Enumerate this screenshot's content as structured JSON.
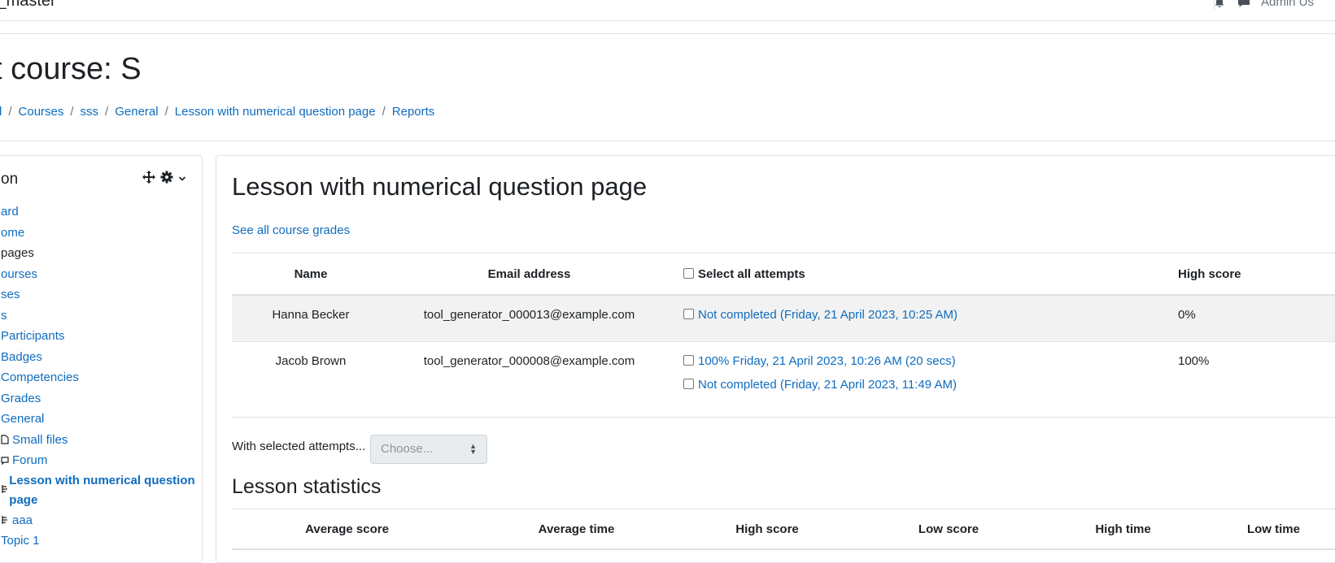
{
  "navbar": {
    "site_name": "l_master",
    "user_name": "Admin Us"
  },
  "header": {
    "page_title": "t course: S",
    "breadcrumb": [
      "d",
      "Courses",
      "sss",
      "General",
      "Lesson with numerical question page",
      "Reports"
    ]
  },
  "navigation_block": {
    "title": "on",
    "items": [
      {
        "label": "ard",
        "type": "link"
      },
      {
        "label": "ome",
        "type": "link"
      },
      {
        "label": "pages",
        "type": "static"
      },
      {
        "label": "ourses",
        "type": "link"
      },
      {
        "label": "ses",
        "type": "link"
      },
      {
        "label": "s",
        "type": "link"
      },
      {
        "label": "Participants",
        "type": "link"
      },
      {
        "label": "Badges",
        "type": "link"
      },
      {
        "label": "Competencies",
        "type": "link"
      },
      {
        "label": "Grades",
        "type": "link"
      },
      {
        "label": "General",
        "type": "link"
      },
      {
        "label": "Small files",
        "type": "link",
        "icon": "file-icon"
      },
      {
        "label": "Forum",
        "type": "link",
        "icon": "forum-icon"
      },
      {
        "label": "Lesson with numerical question page",
        "type": "current",
        "icon": "lesson-icon"
      },
      {
        "label": "aaa",
        "type": "link",
        "icon": "lesson-icon"
      },
      {
        "label": "Topic 1",
        "type": "link"
      }
    ]
  },
  "main": {
    "lesson_title": "Lesson with numerical question page",
    "see_all_grades": "See all course grades",
    "attempts_table": {
      "headers": {
        "name": "Name",
        "email": "Email address",
        "select_all": "Select all attempts",
        "high_score": "High score"
      },
      "rows": [
        {
          "name": "Hanna Becker",
          "email": "tool_generator_000013@example.com",
          "attempts": [
            "Not completed (Friday, 21 April 2023, 10:25 AM)"
          ],
          "high_score": "0%"
        },
        {
          "name": "Jacob Brown",
          "email": "tool_generator_000008@example.com",
          "attempts": [
            "100% Friday, 21 April 2023, 10:26 AM (20 secs)",
            "Not completed (Friday, 21 April 2023, 11:49 AM)"
          ],
          "high_score": "100%"
        }
      ]
    },
    "with_selected_label": "With selected attempts...",
    "choose_select": {
      "selected": "Choose..."
    },
    "stats_title": "Lesson statistics",
    "stats_headers": [
      "Average score",
      "Average time",
      "High score",
      "Low score",
      "High time",
      "Low time"
    ]
  },
  "colors": {
    "link": "#0f6cbf",
    "text": "#1d2125",
    "border": "#dee2e6",
    "stripe": "#f2f2f2"
  }
}
